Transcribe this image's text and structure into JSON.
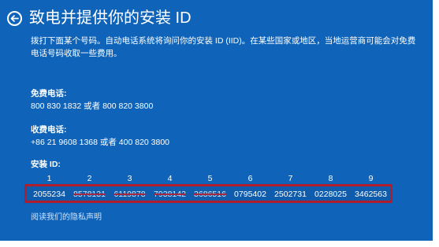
{
  "header": {
    "title": "致电并提供你的安装 ID",
    "back_icon": "arrow-left-icon"
  },
  "description": "拨打下面某个号码。自动电话系统将询问你的安装 ID (IID)。在某些国家或地区，当地运营商可能会对免费电话号码收取一些费用。",
  "toll_free": {
    "label": "免费电话:",
    "numbers": "800 830 1832 或者 800 820 3800"
  },
  "toll": {
    "label": "收费电话:",
    "numbers": "+86 21 9608 1368 或者 400 820 3800"
  },
  "install_id": {
    "label": "安装 ID:",
    "columns": [
      "1",
      "2",
      "3",
      "4",
      "5",
      "6",
      "7",
      "8",
      "9"
    ],
    "groups": [
      "2055234",
      "8578131",
      "6119878",
      "7938142",
      "3686516",
      "0795402",
      "2502731",
      "0228025",
      "3462563"
    ],
    "highlight_color": "#b01e2e"
  },
  "privacy_link": "阅读我们的隐私声明",
  "colors": {
    "background": "#0f64b9",
    "text": "#ffffff"
  }
}
